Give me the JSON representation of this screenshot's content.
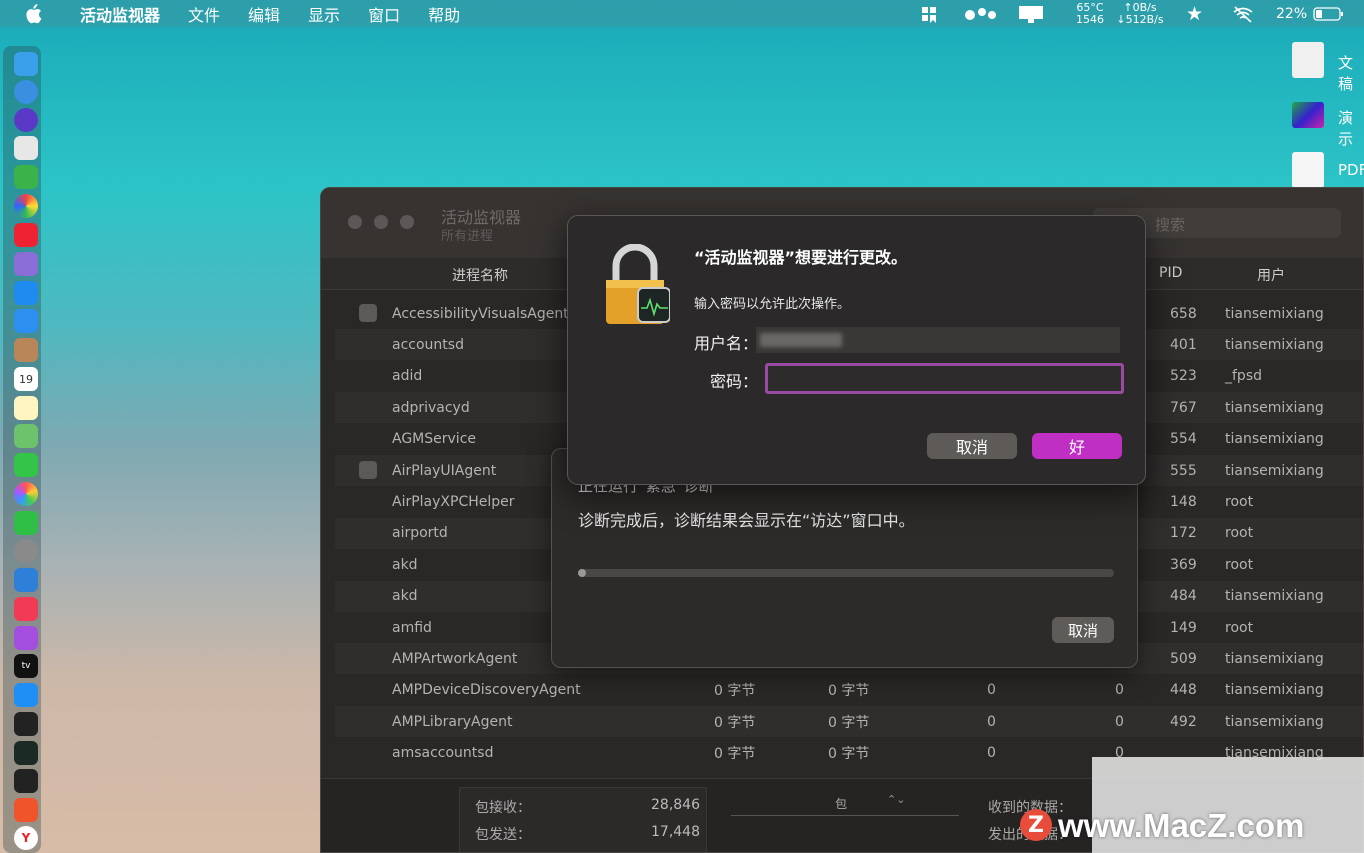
{
  "menubar": {
    "app": "活动监视器",
    "items": [
      "文件",
      "编辑",
      "显示",
      "窗口",
      "帮助"
    ],
    "temp": "65°C",
    "rpm": "1546",
    "net_up": "↑0B/s",
    "net_down": "↓512B/s",
    "battery": "22%"
  },
  "desktop": {
    "items": [
      "文稿",
      "演示",
      "PDF"
    ]
  },
  "window": {
    "title": "活动监视器",
    "subtitle": "所有进程",
    "search_placeholder": "搜索",
    "columns": {
      "name": "进程名称",
      "pid": "PID",
      "user": "用户"
    },
    "rows": [
      {
        "name": "AccessibilityVisualsAgent",
        "sent": "",
        "recv": "",
        "a": "",
        "b": "",
        "pid": "658",
        "user": "tiansemixiang",
        "chk": true
      },
      {
        "name": "accountsd",
        "sent": "",
        "recv": "",
        "a": "",
        "b": "",
        "pid": "401",
        "user": "tiansemixiang"
      },
      {
        "name": "adid",
        "sent": "",
        "recv": "",
        "a": "",
        "b": "",
        "pid": "523",
        "user": "_fpsd"
      },
      {
        "name": "adprivacyd",
        "sent": "",
        "recv": "",
        "a": "",
        "b": "",
        "pid": "767",
        "user": "tiansemixiang"
      },
      {
        "name": "AGMService",
        "sent": "",
        "recv": "",
        "a": "",
        "b": "",
        "pid": "554",
        "user": "tiansemixiang"
      },
      {
        "name": "AirPlayUIAgent",
        "sent": "",
        "recv": "",
        "a": "",
        "b": "",
        "pid": "555",
        "user": "tiansemixiang",
        "chk": true
      },
      {
        "name": "AirPlayXPCHelper",
        "sent": "",
        "recv": "",
        "a": "",
        "b": "",
        "pid": "148",
        "user": "root"
      },
      {
        "name": "airportd",
        "sent": "",
        "recv": "",
        "a": "",
        "b": "",
        "pid": "172",
        "user": "root"
      },
      {
        "name": "akd",
        "sent": "",
        "recv": "",
        "a": "",
        "b": "",
        "pid": "369",
        "user": "root"
      },
      {
        "name": "akd",
        "sent": "",
        "recv": "",
        "a": "",
        "b": "",
        "pid": "484",
        "user": "tiansemixiang"
      },
      {
        "name": "amfid",
        "sent": "",
        "recv": "",
        "a": "",
        "b": "",
        "pid": "149",
        "user": "root"
      },
      {
        "name": "AMPArtworkAgent",
        "sent": "",
        "recv": "",
        "a": "",
        "b": "",
        "pid": "509",
        "user": "tiansemixiang"
      },
      {
        "name": "AMPDeviceDiscoveryAgent",
        "sent": "0 字节",
        "recv": "0 字节",
        "a": "0",
        "b": "0",
        "pid": "448",
        "user": "tiansemixiang"
      },
      {
        "name": "AMPLibraryAgent",
        "sent": "0 字节",
        "recv": "0 字节",
        "a": "0",
        "b": "0",
        "pid": "492",
        "user": "tiansemixiang"
      },
      {
        "name": "amsaccountsd",
        "sent": "0 字节",
        "recv": "0 字节",
        "a": "0",
        "b": "0",
        "pid": "",
        "user": "tiansemixiang"
      }
    ],
    "footer": {
      "recv_label": "包接收：",
      "recv_val": "28,846",
      "sent_label": "包发送：",
      "sent_val": "17,448",
      "unit": "包",
      "data_recv": "收到的数据：",
      "data_sent": "发出的数据："
    }
  },
  "diag": {
    "line1": "正在运行“紧急”诊断",
    "line2": "诊断完成后，诊断结果会显示在“访达”窗口中。",
    "progress": 0.0,
    "cancel": "取消"
  },
  "auth": {
    "title": "“活动监视器”想要进行更改。",
    "subtitle": "输入密码以允许此次操作。",
    "user_label": "用户名：",
    "pass_label": "密码：",
    "cancel": "取消",
    "ok": "好",
    "accent": "#c02fc4"
  },
  "watermark": {
    "text": "www.MacZ.com",
    "logo": "Z"
  }
}
